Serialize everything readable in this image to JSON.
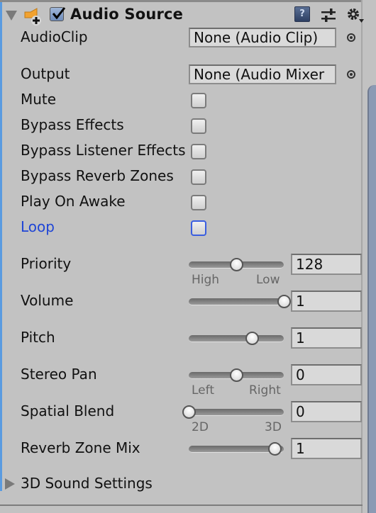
{
  "header": {
    "title": "Audio Source",
    "enabled": true,
    "icons": [
      "foldout-expanded-icon",
      "audio-source-add-icon",
      "help-book-icon",
      "preset-sliders-icon",
      "gear-menu-icon"
    ],
    "help_glyph": "?"
  },
  "fields": {
    "audio_clip": {
      "label": "AudioClip",
      "value": "None (Audio Clip)"
    },
    "output": {
      "label": "Output",
      "value": "None (Audio Mixer"
    }
  },
  "toggles": [
    {
      "label": "Mute",
      "checked": false
    },
    {
      "label": "Bypass Effects",
      "checked": false
    },
    {
      "label": "Bypass Listener Effects",
      "checked": false
    },
    {
      "label": "Bypass Reverb Zones",
      "checked": false
    },
    {
      "label": "Play On Awake",
      "checked": false
    },
    {
      "label": "Loop",
      "checked": false,
      "focused": true
    }
  ],
  "sliders": [
    {
      "label": "Priority",
      "value": "128",
      "min": 0,
      "max": 256,
      "num": 128,
      "min_label": "High",
      "max_label": "Low"
    },
    {
      "label": "Volume",
      "value": "1",
      "min": 0,
      "max": 1,
      "num": 1
    },
    {
      "label": "Pitch",
      "value": "1",
      "min": -3,
      "max": 3,
      "num": 1
    },
    {
      "label": "Stereo Pan",
      "value": "0",
      "min": -1,
      "max": 1,
      "num": 0,
      "min_label": "Left",
      "max_label": "Right"
    },
    {
      "label": "Spatial Blend",
      "value": "0",
      "min": 0,
      "max": 1,
      "num": 0,
      "min_label": "2D",
      "max_label": "3D"
    },
    {
      "label": "Reverb Zone Mix",
      "value": "1",
      "min": 0,
      "max": 1.1,
      "num": 1
    }
  ],
  "sound_settings": {
    "label": "3D Sound Settings",
    "expanded": false
  },
  "colors": {
    "accent_blue": "#1f45d6",
    "panel_bg": "#c2c2c2",
    "selection_bar": "#5a9be0"
  }
}
